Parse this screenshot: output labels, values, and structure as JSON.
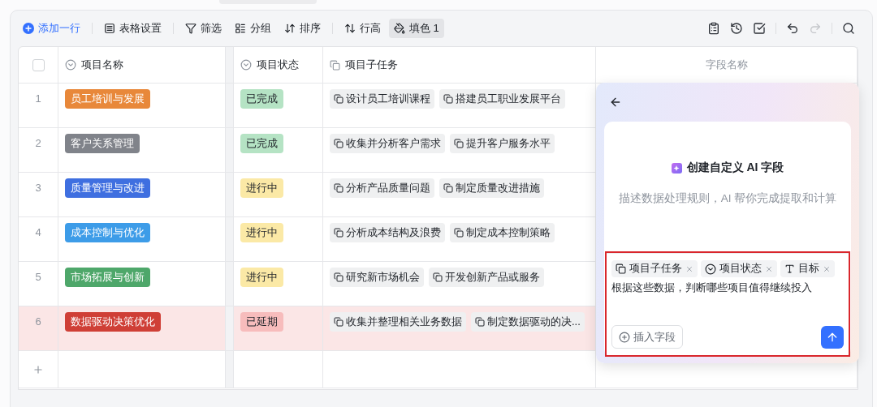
{
  "toolbar": {
    "add_row": "添加一行",
    "items": [
      {
        "label": "表格设置",
        "selected": false
      },
      {
        "label": "筛选",
        "selected": false
      },
      {
        "label": "分组",
        "selected": false
      },
      {
        "label": "排序",
        "selected": false
      },
      {
        "label": "行高",
        "selected": false
      },
      {
        "label": "填色 1",
        "selected": true
      }
    ],
    "actions": [
      {
        "kind": "clipboard",
        "disabled": false
      },
      {
        "kind": "history",
        "disabled": false
      },
      {
        "kind": "check",
        "disabled": false
      },
      {
        "kind": "undo",
        "disabled": false
      },
      {
        "kind": "redo",
        "disabled": true
      },
      {
        "kind": "search",
        "disabled": false
      }
    ]
  },
  "table": {
    "select_all": {
      "checked": false
    },
    "columns": [
      {
        "label": "项目名称",
        "kind": "select"
      },
      {
        "label": "项目状态",
        "kind": "select"
      },
      {
        "label": "项目子任务",
        "kind": "link"
      },
      {
        "label": "字段名称",
        "kind": "ai"
      }
    ],
    "rows": [
      {
        "number": "1",
        "highlighted": false,
        "name": {
          "text": "员工培训与发展",
          "color": "#e8883a"
        },
        "status": {
          "text": "已完成",
          "color": "#b5e3c4"
        },
        "subtasks": [
          "设计员工培训课程",
          "搭建员工职业发展平台"
        ]
      },
      {
        "number": "2",
        "highlighted": false,
        "name": {
          "text": "客户关系管理",
          "color": "#80838a"
        },
        "status": {
          "text": "已完成",
          "color": "#b5e3c4"
        },
        "subtasks": [
          "收集并分析客户需求",
          "提升客户服务水平"
        ]
      },
      {
        "number": "3",
        "highlighted": false,
        "name": {
          "text": "质量管理与改进",
          "color": "#3f6fe0"
        },
        "status": {
          "text": "进行中",
          "color": "#fbe9a6"
        },
        "subtasks": [
          "分析产品质量问题",
          "制定质量改进措施"
        ]
      },
      {
        "number": "4",
        "highlighted": false,
        "name": {
          "text": "成本控制与优化",
          "color": "#3d9ce8"
        },
        "status": {
          "text": "进行中",
          "color": "#fbe9a6"
        },
        "subtasks": [
          "分析成本结构及浪费",
          "制定成本控制策略"
        ]
      },
      {
        "number": "5",
        "highlighted": false,
        "name": {
          "text": "市场拓展与创新",
          "color": "#4ea76a"
        },
        "status": {
          "text": "进行中",
          "color": "#fbe9a6"
        },
        "subtasks": [
          "研究新市场机会",
          "开发创新产品或服务"
        ]
      },
      {
        "number": "6",
        "highlighted": true,
        "name": {
          "text": "数据驱动决策优化",
          "color": "#cf3f36"
        },
        "status": {
          "text": "已延期",
          "color": "#f7bcbc"
        },
        "subtasks": [
          "收集并整理相关业务数据",
          "制定数据驱动的决..."
        ]
      }
    ]
  },
  "ai_panel": {
    "title": "创建自定义 AI 字段",
    "subtitle": "描述数据处理规则，AI 帮你完成提取和计算",
    "chips": [
      {
        "label": "项目子任务",
        "kind": "link"
      },
      {
        "label": "项目状态",
        "kind": "select"
      },
      {
        "label": "目标",
        "kind": "text"
      }
    ],
    "prompt": "根据这些数据，判断哪些项目值得继续投入",
    "insert_button": "插入字段"
  }
}
